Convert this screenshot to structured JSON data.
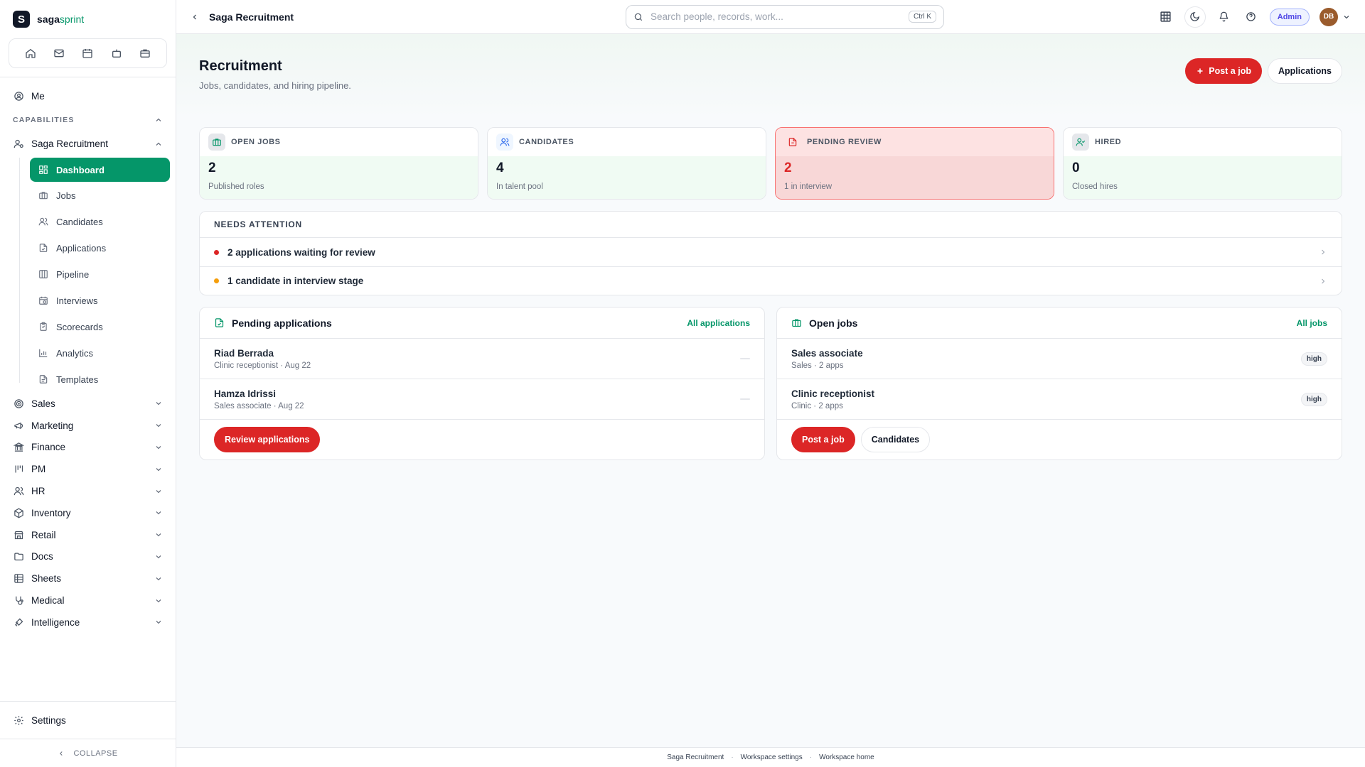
{
  "brand": {
    "logo_letter": "S",
    "name_a": "saga",
    "name_b": "sprint"
  },
  "sidebar": {
    "me": "Me",
    "capabilities_label": "CAPABILITIES",
    "recruitment_label": "Saga Recruitment",
    "sub_items": [
      {
        "label": "Dashboard",
        "icon": "dashboard-icon"
      },
      {
        "label": "Jobs",
        "icon": "briefcase-icon"
      },
      {
        "label": "Candidates",
        "icon": "users-icon"
      },
      {
        "label": "Applications",
        "icon": "file-check-icon"
      },
      {
        "label": "Pipeline",
        "icon": "columns-icon"
      },
      {
        "label": "Interviews",
        "icon": "calendar-clock-icon"
      },
      {
        "label": "Scorecards",
        "icon": "clipboard-icon"
      },
      {
        "label": "Analytics",
        "icon": "bar-chart-icon"
      },
      {
        "label": "Templates",
        "icon": "document-icon"
      }
    ],
    "groups": [
      "Sales",
      "Marketing",
      "Finance",
      "PM",
      "HR",
      "Inventory",
      "Retail",
      "Docs",
      "Sheets",
      "Medical",
      "Intelligence"
    ],
    "settings": "Settings",
    "collapse": "COLLAPSE"
  },
  "topbar": {
    "breadcrumb": "Saga Recruitment",
    "search_placeholder": "Search people, records, work...",
    "shortcut": "Ctrl K",
    "role": "Admin",
    "avatar_initials": "DB"
  },
  "page": {
    "title": "Recruitment",
    "subtitle": "Jobs, candidates, and hiring pipeline.",
    "post_job": "Post a job",
    "applications": "Applications"
  },
  "stats": [
    {
      "label": "OPEN JOBS",
      "value": "2",
      "note": "Published roles"
    },
    {
      "label": "CANDIDATES",
      "value": "4",
      "note": "In talent pool"
    },
    {
      "label": "PENDING REVIEW",
      "value": "2",
      "note": "1 in interview"
    },
    {
      "label": "HIRED",
      "value": "0",
      "note": "Closed hires"
    }
  ],
  "attention": {
    "title": "NEEDS ATTENTION",
    "items": [
      {
        "text": "2 applications waiting for review",
        "color": "#dc2626"
      },
      {
        "text": "1 candidate in interview stage",
        "color": "#f59e0b"
      }
    ]
  },
  "pending": {
    "title": "Pending applications",
    "link": "All applications",
    "rows": [
      {
        "name": "Riad Berrada",
        "meta": "Clinic receptionist · Aug 22"
      },
      {
        "name": "Hamza Idrissi",
        "meta": "Sales associate · Aug 22"
      }
    ],
    "action": "Review applications"
  },
  "jobs": {
    "title": "Open jobs",
    "link": "All jobs",
    "rows": [
      {
        "name": "Sales associate",
        "meta": "Sales · 2 apps",
        "badge": "high"
      },
      {
        "name": "Clinic receptionist",
        "meta": "Clinic · 2 apps",
        "badge": "high"
      }
    ],
    "action_primary": "Post a job",
    "action_secondary": "Candidates"
  },
  "footer": {
    "links": [
      "Saga Recruitment",
      "Workspace settings",
      "Workspace home"
    ],
    "separator": "·"
  },
  "colors": {
    "accent": "#059669",
    "danger": "#dc2626",
    "warn": "#f59e0b"
  }
}
